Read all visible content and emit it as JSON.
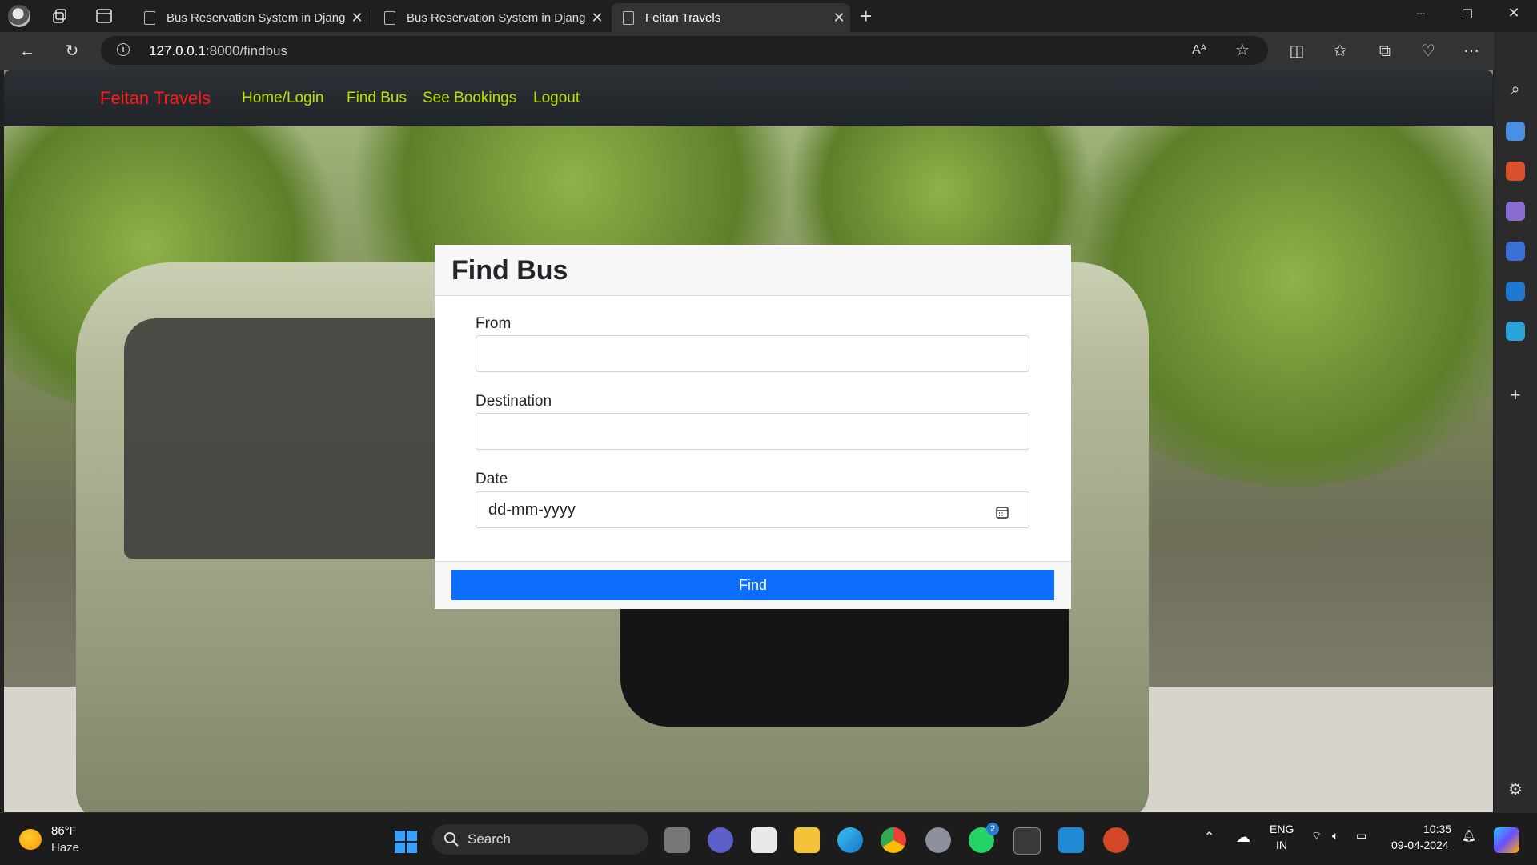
{
  "browser": {
    "tabs": [
      {
        "title": "Bus Reservation System in Djang",
        "active": false
      },
      {
        "title": "Bus Reservation System in Djang",
        "active": false
      },
      {
        "title": "Feitan Travels",
        "active": true
      }
    ],
    "url_host": "127.0.0.1",
    "url_path": ":8000/findbus"
  },
  "navbar": {
    "brand": "Feitan Travels",
    "links": [
      "Home/Login",
      "Find Bus",
      "See Bookings",
      "Logout"
    ]
  },
  "card": {
    "title": "Find Bus",
    "from_label": "From",
    "from_value": "",
    "destination_label": "Destination",
    "destination_value": "",
    "date_label": "Date",
    "date_placeholder": "dd-mm-yyyy",
    "submit_label": "Find"
  },
  "taskbar": {
    "temperature": "86°F",
    "condition": "Haze",
    "search_label": "Search",
    "lang_top": "ENG",
    "lang_bottom": "IN",
    "time": "10:35",
    "date": "09-04-2024",
    "whatsapp_badge": "2"
  },
  "colors": {
    "brand": "#ff1a1a",
    "nav_link": "#b6e600",
    "primary_button": "#0d6efd",
    "navbar_bg": "#212529"
  }
}
